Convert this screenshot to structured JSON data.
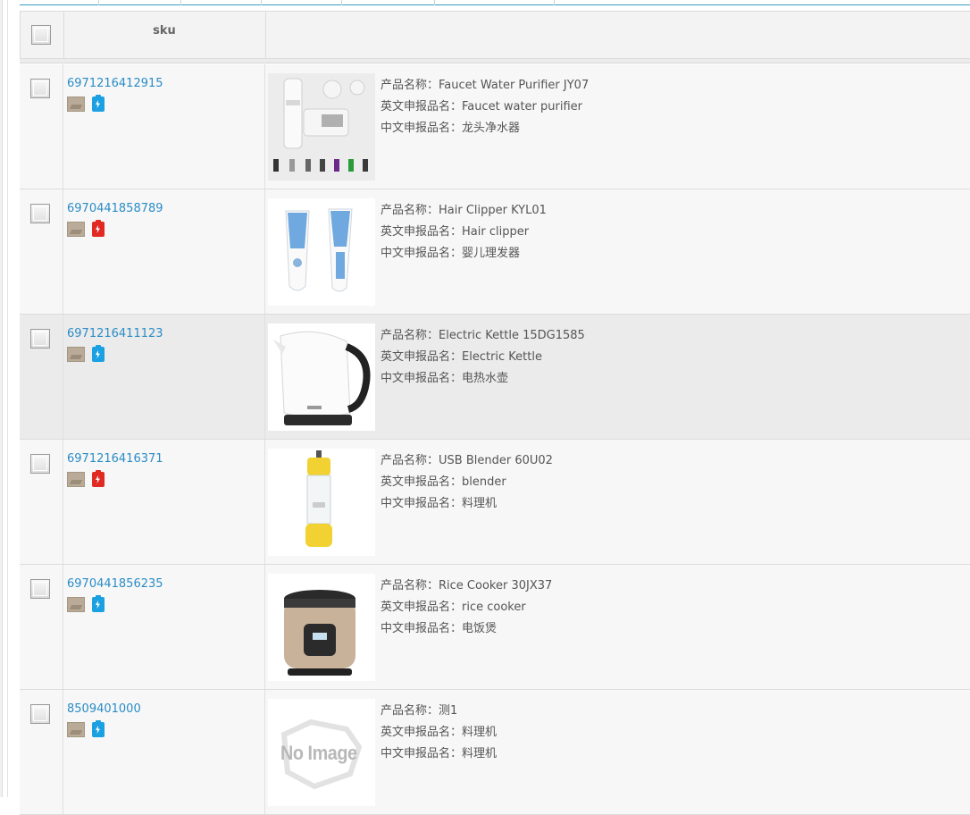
{
  "table": {
    "header": {
      "sku_label": "sku"
    },
    "rows": [
      {
        "sku": "6971216412915",
        "battery_color": "blue",
        "name_line": "产品名称：Faucet Water Purifier JY07",
        "en_line": "英文申报品名：Faucet water purifier",
        "cn_line": "中文申报品名：龙头净水器",
        "image": "faucet-purifier",
        "highlight": false
      },
      {
        "sku": "6970441858789",
        "battery_color": "red",
        "name_line": "产品名称：Hair Clipper KYL01",
        "en_line": "英文申报品名：Hair clipper",
        "cn_line": "中文申报品名：婴儿理发器",
        "image": "hair-clipper",
        "highlight": false
      },
      {
        "sku": "6971216411123",
        "battery_color": "blue",
        "name_line": "产品名称：Electric Kettle 15DG1585",
        "en_line": "英文申报品名：Electric Kettle",
        "cn_line": "中文申报品名：电热水壶",
        "image": "electric-kettle",
        "highlight": true
      },
      {
        "sku": "6971216416371",
        "battery_color": "red",
        "name_line": "产品名称：USB Blender 60U02",
        "en_line": "英文申报品名：blender",
        "cn_line": "中文申报品名：料理机",
        "image": "usb-blender",
        "highlight": false
      },
      {
        "sku": "6970441856235",
        "battery_color": "blue",
        "name_line": "产品名称：Rice Cooker 30JX37",
        "en_line": "英文申报品名：rice cooker",
        "cn_line": "中文申报品名：电饭煲",
        "image": "rice-cooker",
        "highlight": false
      },
      {
        "sku": "8509401000",
        "battery_color": "blue",
        "name_line": "产品名称：测1",
        "en_line": "英文申报品名：料理机",
        "cn_line": "中文申报品名：料理机",
        "image": "no-image",
        "no_image_text": "No Image",
        "highlight": false
      }
    ]
  },
  "colors": {
    "link": "#2a8cc7",
    "row_bg": "#f7f7f7",
    "row_bg_highlight": "#ebebeb",
    "battery_blue": "#1ba1e2",
    "battery_red": "#e02a22"
  }
}
